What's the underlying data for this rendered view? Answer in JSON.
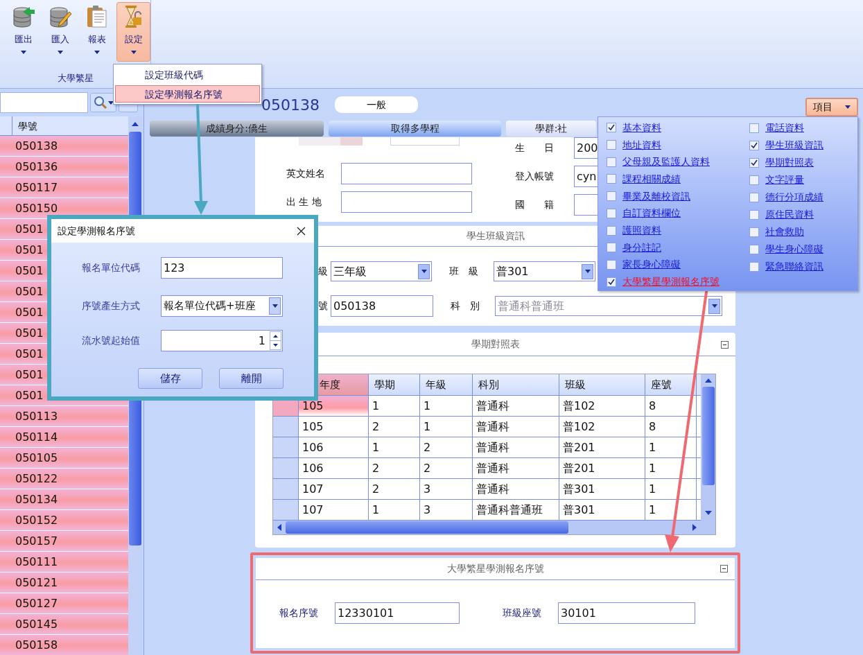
{
  "ribbon": {
    "buttons": [
      {
        "label": "匯出",
        "kind": "export",
        "selected": false
      },
      {
        "label": "匯入",
        "kind": "import",
        "selected": false
      },
      {
        "label": "報表",
        "kind": "report",
        "selected": false
      },
      {
        "label": "設定",
        "kind": "settings",
        "selected": true
      }
    ],
    "group": "大學繁星"
  },
  "settings_menu": {
    "items": [
      {
        "label": "設定班級代碼",
        "selected": false
      },
      {
        "label": "設定學測報名序號",
        "selected": true
      }
    ]
  },
  "student_list": {
    "column": "學號",
    "rows": [
      "050138",
      "050136",
      "050117",
      "050150",
      "0501",
      "0501",
      "0501",
      "0501",
      "0501",
      "0501",
      "0501",
      "0501",
      "0501",
      "050113",
      "050114",
      "050105",
      "050122",
      "050134",
      "050152",
      "050157",
      "050111",
      "050121",
      "050127",
      "050145",
      "050158"
    ]
  },
  "header": {
    "title": "050138",
    "badge": "一般",
    "items_button": "項目"
  },
  "tabs": [
    {
      "label": "成績身分:僑生",
      "kind": "dark"
    },
    {
      "label": "取得多學程",
      "kind": "blue"
    },
    {
      "label": "學群:社",
      "kind": "light"
    }
  ],
  "basic_info": {
    "left": [
      {
        "label": "英文姓名"
      },
      {
        "label": "出 生 地"
      }
    ],
    "right": [
      {
        "label": "生　　日",
        "value": "200"
      },
      {
        "label": "登入帳號",
        "value": "cyn"
      },
      {
        "label": "國　　籍"
      }
    ]
  },
  "class_info": {
    "title": "學生班級資訊",
    "fields": [
      {
        "label": "級",
        "value": "三年級",
        "kind": "select",
        "disabled": false
      },
      {
        "label": "班　級",
        "value": "普301",
        "kind": "select",
        "disabled": false
      },
      {
        "label": "號",
        "value": "050138",
        "kind": "input",
        "disabled": false
      },
      {
        "label": "科　別",
        "value": "普通科普通班",
        "kind": "select",
        "disabled": true
      }
    ]
  },
  "semester_table": {
    "title": "學期對照表",
    "columns": [
      "年度",
      "學期",
      "年級",
      "科別",
      "班級",
      "座號"
    ],
    "rows": [
      {
        "cells": [
          "105",
          "1",
          "1",
          "普通科",
          "普102",
          "8"
        ],
        "selected": true
      },
      {
        "cells": [
          "105",
          "2",
          "1",
          "普通科",
          "普102",
          "8"
        ],
        "selected": false
      },
      {
        "cells": [
          "106",
          "1",
          "2",
          "普通科",
          "普201",
          "1"
        ],
        "selected": false
      },
      {
        "cells": [
          "106",
          "2",
          "2",
          "普通科",
          "普201",
          "1"
        ],
        "selected": false
      },
      {
        "cells": [
          "107",
          "2",
          "3",
          "普通科",
          "普301",
          "1"
        ],
        "selected": false
      },
      {
        "cells": [
          "107",
          "1",
          "3",
          "普通科普通班",
          "普301",
          "1"
        ],
        "selected": false
      }
    ]
  },
  "apply_section": {
    "title": "大學繁星學測報名序號",
    "fields": [
      {
        "label": "報名序號",
        "value": "12330101"
      },
      {
        "label": "班級座號",
        "value": "30101"
      }
    ]
  },
  "checklist": {
    "columns": [
      [
        {
          "label": "基本資料",
          "checked": true,
          "current": false
        },
        {
          "label": "地址資料",
          "checked": false,
          "current": false
        },
        {
          "label": "父母親及監護人資料",
          "checked": false,
          "current": false
        },
        {
          "label": "課程相關成績",
          "checked": false,
          "current": false
        },
        {
          "label": "畢業及離校資訊",
          "checked": false,
          "current": false
        },
        {
          "label": "自訂資料欄位",
          "checked": false,
          "current": false
        },
        {
          "label": "護照資料",
          "checked": false,
          "current": false
        },
        {
          "label": "身分註記",
          "checked": false,
          "current": false
        },
        {
          "label": "家長身心障礙",
          "checked": false,
          "current": false
        },
        {
          "label": "大學繁星學測報名序號",
          "checked": true,
          "current": true
        }
      ],
      [
        {
          "label": "電話資料",
          "checked": false,
          "current": false
        },
        {
          "label": "學生班級資訊",
          "checked": true,
          "current": false
        },
        {
          "label": "學期對照表",
          "checked": true,
          "current": false
        },
        {
          "label": "文字評量",
          "checked": false,
          "current": false
        },
        {
          "label": "德行分項成績",
          "checked": false,
          "current": false
        },
        {
          "label": "原住民資料",
          "checked": false,
          "current": false
        },
        {
          "label": "社會救助",
          "checked": false,
          "current": false
        },
        {
          "label": "學生身心障礙",
          "checked": false,
          "current": false
        },
        {
          "label": "緊急聯絡資訊",
          "checked": false,
          "current": false
        }
      ]
    ]
  },
  "dialog": {
    "title": "設定學測報名序號",
    "fields": [
      {
        "label": "報名單位代碼",
        "value": "123",
        "kind": "input"
      },
      {
        "label": "序號產生方式",
        "value": "報名單位代碼+班座",
        "kind": "select"
      },
      {
        "label": "流水號起始值",
        "value": "1",
        "kind": "spinner"
      }
    ],
    "buttons": [
      "儲存",
      "離開"
    ]
  }
}
